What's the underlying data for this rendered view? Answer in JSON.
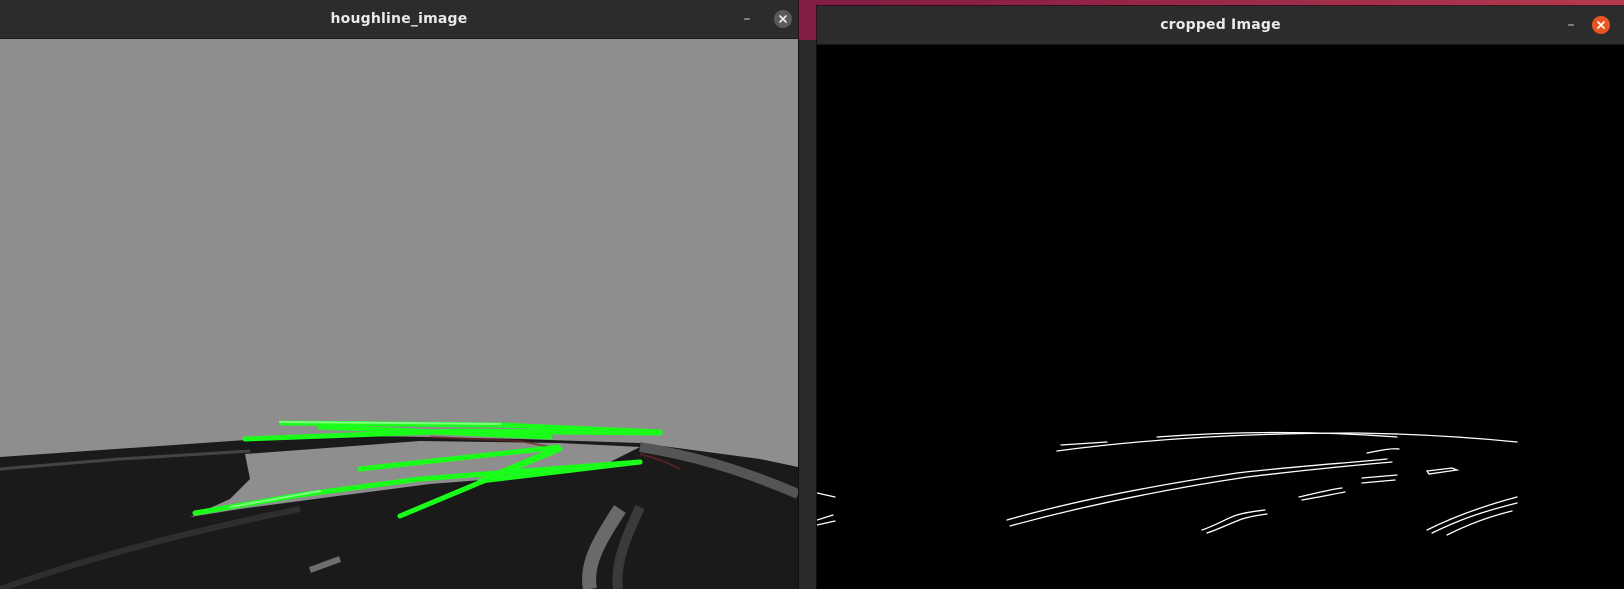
{
  "windows": {
    "hough": {
      "title": "houghline_image",
      "close_color": "#5a5a5a"
    },
    "cropped": {
      "title": "cropped Image",
      "close_color": "#e95420"
    }
  },
  "icons": {
    "minimize": "minimize-icon",
    "close": "close-icon"
  },
  "colors": {
    "hough_background": "#8e8e8e",
    "road": "#1c1c1c",
    "hough_lines": "#19ff19",
    "edge_lines": "#ffffff",
    "cropped_background": "#000000"
  }
}
